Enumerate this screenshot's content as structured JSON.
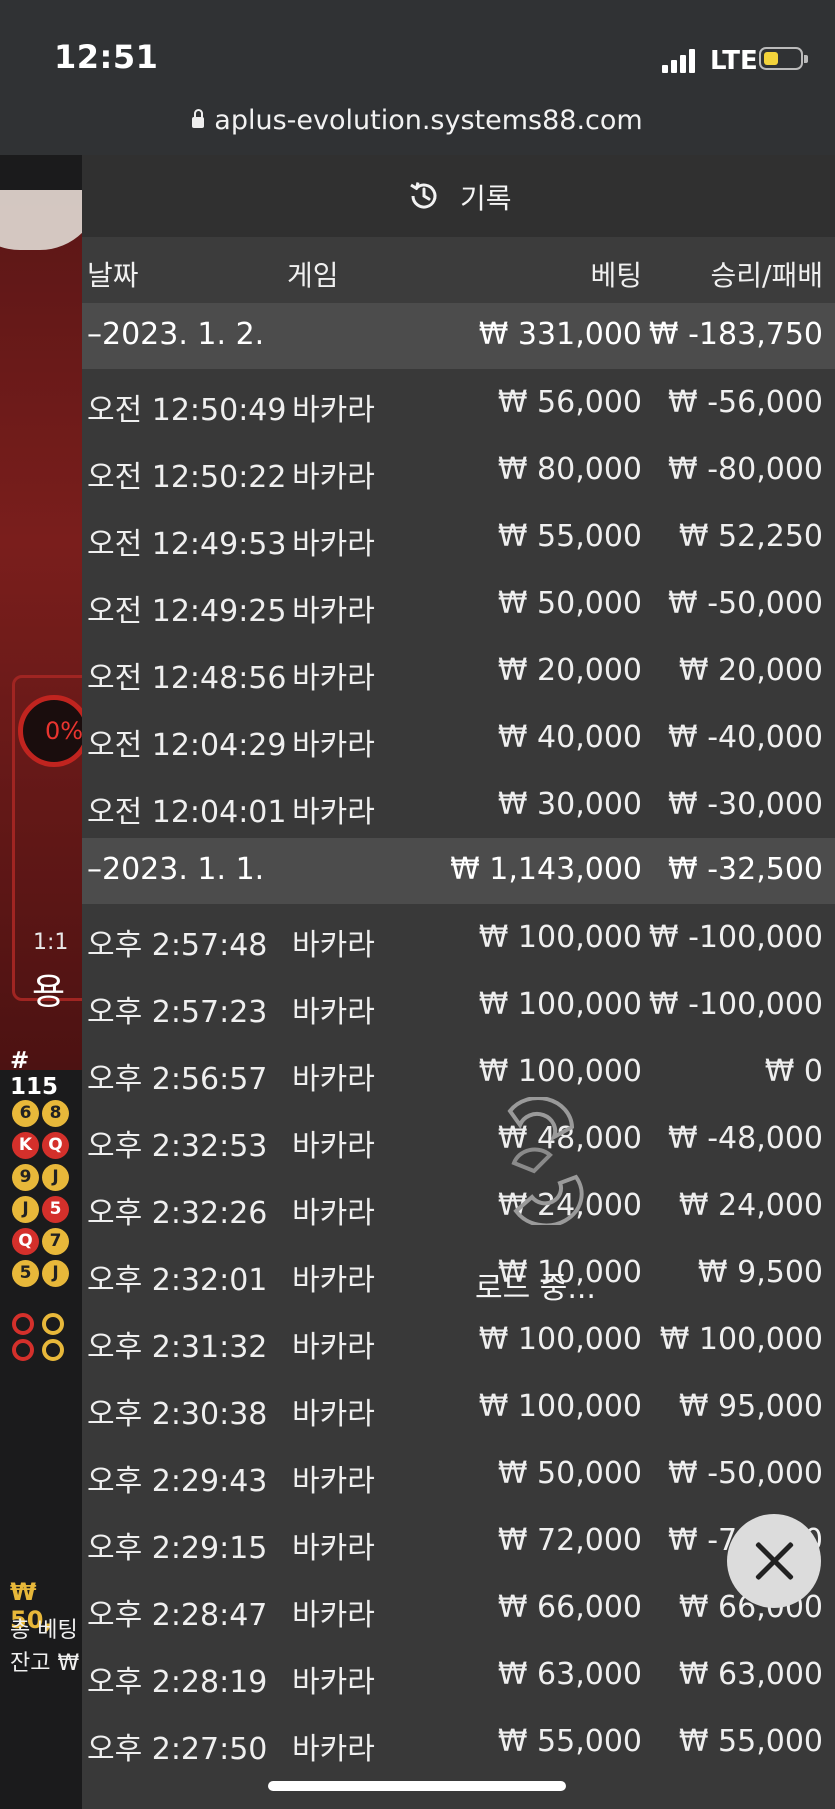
{
  "status": {
    "time": "12:51",
    "network": "LTE"
  },
  "browser": {
    "url": "aplus-evolution.systems88.com"
  },
  "panel": {
    "title": "기록",
    "columns": {
      "date": "날짜",
      "game": "게임",
      "bet": "베팅",
      "result": "승리/패배"
    },
    "groups": [
      {
        "date": "–2023. 1. 2.",
        "bet": "₩ 331,000",
        "result": "₩ -183,750",
        "rows": [
          {
            "time": "오전 12:50:49",
            "game": "바카라",
            "bet": "₩ 56,000",
            "result": "₩ -56,000"
          },
          {
            "time": "오전 12:50:22",
            "game": "바카라",
            "bet": "₩ 80,000",
            "result": "₩ -80,000"
          },
          {
            "time": "오전 12:49:53",
            "game": "바카라",
            "bet": "₩ 55,000",
            "result": "₩ 52,250"
          },
          {
            "time": "오전 12:49:25",
            "game": "바카라",
            "bet": "₩ 50,000",
            "result": "₩ -50,000"
          },
          {
            "time": "오전 12:48:56",
            "game": "바카라",
            "bet": "₩ 20,000",
            "result": "₩ 20,000"
          },
          {
            "time": "오전 12:04:29",
            "game": "바카라",
            "bet": "₩ 40,000",
            "result": "₩ -40,000"
          },
          {
            "time": "오전 12:04:01",
            "game": "바카라",
            "bet": "₩ 30,000",
            "result": "₩ -30,000"
          }
        ]
      },
      {
        "date": "–2023. 1. 1.",
        "bet": "₩ 1,143,000",
        "result": "₩ -32,500",
        "rows": [
          {
            "time": "오후 2:57:48",
            "game": "바카라",
            "bet": "₩ 100,000",
            "result": "₩ -100,000"
          },
          {
            "time": "오후 2:57:23",
            "game": "바카라",
            "bet": "₩ 100,000",
            "result": "₩ -100,000"
          },
          {
            "time": "오후 2:56:57",
            "game": "바카라",
            "bet": "₩ 100,000",
            "result": "₩ 0"
          },
          {
            "time": "오후 2:32:53",
            "game": "바카라",
            "bet": "₩ 48,000",
            "result": "₩ -48,000"
          },
          {
            "time": "오후 2:32:26",
            "game": "바카라",
            "bet": "₩ 24,000",
            "result": "₩ 24,000"
          },
          {
            "time": "오후 2:32:01",
            "game": "바카라",
            "bet": "₩ 10,000",
            "result": "₩ 9,500"
          },
          {
            "time": "오후 2:31:32",
            "game": "바카라",
            "bet": "₩ 100,000",
            "result": "₩ 100,000"
          },
          {
            "time": "오후 2:30:38",
            "game": "바카라",
            "bet": "₩ 100,000",
            "result": "₩ 95,000"
          },
          {
            "time": "오후 2:29:43",
            "game": "바카라",
            "bet": "₩ 50,000",
            "result": "₩ -50,000"
          },
          {
            "time": "오후 2:29:15",
            "game": "바카라",
            "bet": "₩ 72,000",
            "result": "₩ -72,000"
          },
          {
            "time": "오후 2:28:47",
            "game": "바카라",
            "bet": "₩ 66,000",
            "result": "₩ 66,000"
          },
          {
            "time": "오후 2:28:19",
            "game": "바카라",
            "bet": "₩ 63,000",
            "result": "₩ 63,000"
          },
          {
            "time": "오후 2:27:50",
            "game": "바카라",
            "bet": "₩ 55,000",
            "result": "₩ 55,000"
          }
        ]
      }
    ],
    "loading_text": "로드 중..."
  },
  "background": {
    "percent": "0%",
    "ratio": "1:1",
    "side": "용",
    "shoe_no": "# 115",
    "card_rows": [
      [
        "6",
        "8"
      ],
      [
        "K",
        "Q"
      ],
      [
        "9",
        "J"
      ],
      [
        "J",
        "5"
      ],
      [
        "Q",
        "7"
      ],
      [
        "5",
        "J"
      ]
    ],
    "bet_amount": "₩ 50,",
    "total_bet": "총 베팅",
    "balance": "잔고 ₩"
  },
  "icons": {
    "history": "history-icon",
    "close": "close-icon",
    "lock": "lock-icon",
    "loader": "loading-spinner-icon"
  },
  "colors": {
    "panel": "#3a3a3a",
    "group_row": "#4c4c4c",
    "dragon_red": "#d4302b",
    "accent_yellow": "#e8b83a"
  }
}
